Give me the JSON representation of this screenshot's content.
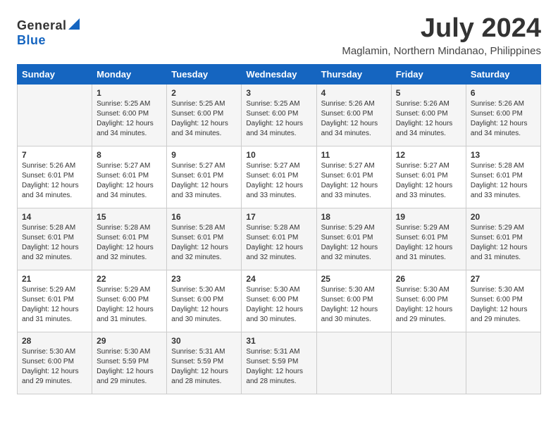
{
  "logo": {
    "general": "General",
    "blue": "Blue"
  },
  "title": "July 2024",
  "location": "Maglamin, Northern Mindanao, Philippines",
  "days_header": [
    "Sunday",
    "Monday",
    "Tuesday",
    "Wednesday",
    "Thursday",
    "Friday",
    "Saturday"
  ],
  "weeks": [
    [
      {
        "day": "",
        "content": ""
      },
      {
        "day": "1",
        "content": "Sunrise: 5:25 AM\nSunset: 6:00 PM\nDaylight: 12 hours\nand 34 minutes."
      },
      {
        "day": "2",
        "content": "Sunrise: 5:25 AM\nSunset: 6:00 PM\nDaylight: 12 hours\nand 34 minutes."
      },
      {
        "day": "3",
        "content": "Sunrise: 5:25 AM\nSunset: 6:00 PM\nDaylight: 12 hours\nand 34 minutes."
      },
      {
        "day": "4",
        "content": "Sunrise: 5:26 AM\nSunset: 6:00 PM\nDaylight: 12 hours\nand 34 minutes."
      },
      {
        "day": "5",
        "content": "Sunrise: 5:26 AM\nSunset: 6:00 PM\nDaylight: 12 hours\nand 34 minutes."
      },
      {
        "day": "6",
        "content": "Sunrise: 5:26 AM\nSunset: 6:00 PM\nDaylight: 12 hours\nand 34 minutes."
      }
    ],
    [
      {
        "day": "7",
        "content": "Sunrise: 5:26 AM\nSunset: 6:01 PM\nDaylight: 12 hours\nand 34 minutes."
      },
      {
        "day": "8",
        "content": "Sunrise: 5:27 AM\nSunset: 6:01 PM\nDaylight: 12 hours\nand 34 minutes."
      },
      {
        "day": "9",
        "content": "Sunrise: 5:27 AM\nSunset: 6:01 PM\nDaylight: 12 hours\nand 33 minutes."
      },
      {
        "day": "10",
        "content": "Sunrise: 5:27 AM\nSunset: 6:01 PM\nDaylight: 12 hours\nand 33 minutes."
      },
      {
        "day": "11",
        "content": "Sunrise: 5:27 AM\nSunset: 6:01 PM\nDaylight: 12 hours\nand 33 minutes."
      },
      {
        "day": "12",
        "content": "Sunrise: 5:27 AM\nSunset: 6:01 PM\nDaylight: 12 hours\nand 33 minutes."
      },
      {
        "day": "13",
        "content": "Sunrise: 5:28 AM\nSunset: 6:01 PM\nDaylight: 12 hours\nand 33 minutes."
      }
    ],
    [
      {
        "day": "14",
        "content": "Sunrise: 5:28 AM\nSunset: 6:01 PM\nDaylight: 12 hours\nand 32 minutes."
      },
      {
        "day": "15",
        "content": "Sunrise: 5:28 AM\nSunset: 6:01 PM\nDaylight: 12 hours\nand 32 minutes."
      },
      {
        "day": "16",
        "content": "Sunrise: 5:28 AM\nSunset: 6:01 PM\nDaylight: 12 hours\nand 32 minutes."
      },
      {
        "day": "17",
        "content": "Sunrise: 5:28 AM\nSunset: 6:01 PM\nDaylight: 12 hours\nand 32 minutes."
      },
      {
        "day": "18",
        "content": "Sunrise: 5:29 AM\nSunset: 6:01 PM\nDaylight: 12 hours\nand 32 minutes."
      },
      {
        "day": "19",
        "content": "Sunrise: 5:29 AM\nSunset: 6:01 PM\nDaylight: 12 hours\nand 31 minutes."
      },
      {
        "day": "20",
        "content": "Sunrise: 5:29 AM\nSunset: 6:01 PM\nDaylight: 12 hours\nand 31 minutes."
      }
    ],
    [
      {
        "day": "21",
        "content": "Sunrise: 5:29 AM\nSunset: 6:01 PM\nDaylight: 12 hours\nand 31 minutes."
      },
      {
        "day": "22",
        "content": "Sunrise: 5:29 AM\nSunset: 6:00 PM\nDaylight: 12 hours\nand 31 minutes."
      },
      {
        "day": "23",
        "content": "Sunrise: 5:30 AM\nSunset: 6:00 PM\nDaylight: 12 hours\nand 30 minutes."
      },
      {
        "day": "24",
        "content": "Sunrise: 5:30 AM\nSunset: 6:00 PM\nDaylight: 12 hours\nand 30 minutes."
      },
      {
        "day": "25",
        "content": "Sunrise: 5:30 AM\nSunset: 6:00 PM\nDaylight: 12 hours\nand 30 minutes."
      },
      {
        "day": "26",
        "content": "Sunrise: 5:30 AM\nSunset: 6:00 PM\nDaylight: 12 hours\nand 29 minutes."
      },
      {
        "day": "27",
        "content": "Sunrise: 5:30 AM\nSunset: 6:00 PM\nDaylight: 12 hours\nand 29 minutes."
      }
    ],
    [
      {
        "day": "28",
        "content": "Sunrise: 5:30 AM\nSunset: 6:00 PM\nDaylight: 12 hours\nand 29 minutes."
      },
      {
        "day": "29",
        "content": "Sunrise: 5:30 AM\nSunset: 5:59 PM\nDaylight: 12 hours\nand 29 minutes."
      },
      {
        "day": "30",
        "content": "Sunrise: 5:31 AM\nSunset: 5:59 PM\nDaylight: 12 hours\nand 28 minutes."
      },
      {
        "day": "31",
        "content": "Sunrise: 5:31 AM\nSunset: 5:59 PM\nDaylight: 12 hours\nand 28 minutes."
      },
      {
        "day": "",
        "content": ""
      },
      {
        "day": "",
        "content": ""
      },
      {
        "day": "",
        "content": ""
      }
    ]
  ]
}
